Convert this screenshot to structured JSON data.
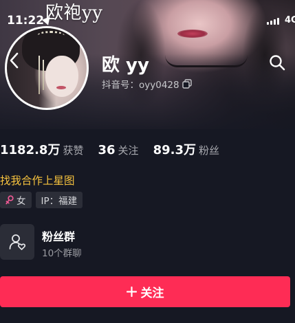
{
  "banner": {
    "caption": "欧袍yy"
  },
  "status_bar": {
    "time": "11:22",
    "network": "4G"
  },
  "profile": {
    "nickname": "欧 yy",
    "douyin_id": "抖音号：oyy0428"
  },
  "stats": [
    {
      "value": "1182.8万",
      "label": "获赞"
    },
    {
      "value": "36",
      "label": "关注"
    },
    {
      "value": "89.3万",
      "label": "粉丝"
    }
  ],
  "bio": "找我合作上星图",
  "tags": {
    "gender": "女",
    "ip": "IP：福建"
  },
  "fan_group": {
    "title": "粉丝群",
    "subtitle": "10个群聊"
  },
  "follow": {
    "label": "关注"
  },
  "colors": {
    "accent": "#fe2c55",
    "bio": "#f6c23e",
    "background": "#161823"
  },
  "icons": [
    "back-icon",
    "search-icon",
    "copy-icon",
    "female-icon",
    "fan-group-icon",
    "plus-icon",
    "location-arrow-icon",
    "signal-icon"
  ]
}
